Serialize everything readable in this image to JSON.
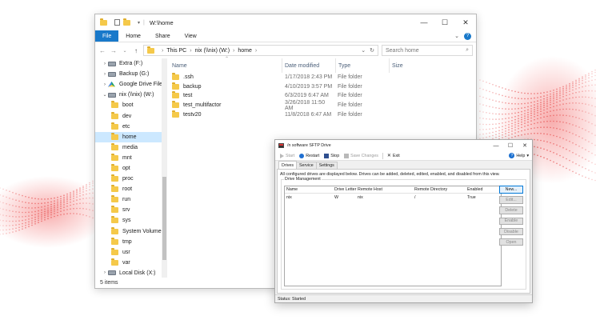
{
  "explorer": {
    "title": "W:\\home",
    "ribbon_tabs": [
      "File",
      "Home",
      "Share",
      "View"
    ],
    "address": {
      "crumbs": [
        "This PC",
        "nix (\\\\nix) (W:)",
        "home"
      ]
    },
    "search_placeholder": "Search home",
    "nav": [
      {
        "label": "Extra (F:)",
        "icon": "drive-icon",
        "level": 0,
        "selected": false
      },
      {
        "label": "Backup (G:)",
        "icon": "drive-icon",
        "level": 0,
        "selected": false
      },
      {
        "label": "Google Drive File",
        "icon": "google-drive-icon",
        "level": 0,
        "selected": false
      },
      {
        "label": "nix (\\\\nix) (W:)",
        "icon": "drive-icon",
        "level": 0,
        "selected": false
      },
      {
        "label": "boot",
        "icon": "folder-icon",
        "level": 1,
        "selected": false
      },
      {
        "label": "dev",
        "icon": "folder-icon",
        "level": 1,
        "selected": false
      },
      {
        "label": "etc",
        "icon": "folder-icon",
        "level": 1,
        "selected": false
      },
      {
        "label": "home",
        "icon": "folder-icon",
        "level": 1,
        "selected": true
      },
      {
        "label": "media",
        "icon": "folder-icon",
        "level": 1,
        "selected": false
      },
      {
        "label": "mnt",
        "icon": "folder-icon",
        "level": 1,
        "selected": false
      },
      {
        "label": "opt",
        "icon": "folder-icon",
        "level": 1,
        "selected": false
      },
      {
        "label": "proc",
        "icon": "folder-icon",
        "level": 1,
        "selected": false
      },
      {
        "label": "root",
        "icon": "folder-icon",
        "level": 1,
        "selected": false
      },
      {
        "label": "run",
        "icon": "folder-icon",
        "level": 1,
        "selected": false
      },
      {
        "label": "srv",
        "icon": "folder-icon",
        "level": 1,
        "selected": false
      },
      {
        "label": "sys",
        "icon": "folder-icon",
        "level": 1,
        "selected": false
      },
      {
        "label": "System Volume",
        "icon": "folder-icon",
        "level": 1,
        "selected": false
      },
      {
        "label": "tmp",
        "icon": "folder-icon",
        "level": 1,
        "selected": false
      },
      {
        "label": "usr",
        "icon": "folder-icon",
        "level": 1,
        "selected": false
      },
      {
        "label": "var",
        "icon": "folder-icon",
        "level": 1,
        "selected": false
      },
      {
        "label": "Local Disk (X:)",
        "icon": "drive-icon",
        "level": 0,
        "selected": false
      }
    ],
    "columns": {
      "name": "Name",
      "date": "Date modified",
      "type": "Type",
      "size": "Size"
    },
    "files": [
      {
        "name": ".ssh",
        "date": "1/17/2018 2:43 PM",
        "type": "File folder"
      },
      {
        "name": "backup",
        "date": "4/10/2019 3:57 PM",
        "type": "File folder"
      },
      {
        "name": "test",
        "date": "6/3/2019 6:47 AM",
        "type": "File folder"
      },
      {
        "name": "test_multifactor",
        "date": "3/26/2018 11:50 AM",
        "type": "File folder"
      },
      {
        "name": "testv20",
        "date": "11/8/2018 6:47 AM",
        "type": "File folder"
      }
    ],
    "status": "5 items"
  },
  "sftp": {
    "title": "/n software SFTP Drive",
    "toolbar": {
      "start": "Start",
      "restart": "Restart",
      "stop": "Stop",
      "save": "Save Changes",
      "exit": "Exit",
      "help": "Help"
    },
    "tabs": [
      "Drives",
      "Service",
      "Settings"
    ],
    "description": "All configured drives are displayed below. Drives can be added, deleted, edited, enabled, and disabled from this view.",
    "group_label": "Drive Management",
    "grid_columns": {
      "name": "Name",
      "letter": "Drive Letter",
      "host": "Remote Host",
      "dir": "Remote Directory",
      "enabled": "Enabled"
    },
    "drives": [
      {
        "name": "nix",
        "letter": "W",
        "host": "nix",
        "dir": "/",
        "enabled": "True"
      }
    ],
    "buttons": {
      "new": "New...",
      "edit": "Edit...",
      "delete": "Delete",
      "enable": "Enable",
      "disable": "Disable",
      "open": "Open"
    },
    "status": "Status: Started"
  }
}
